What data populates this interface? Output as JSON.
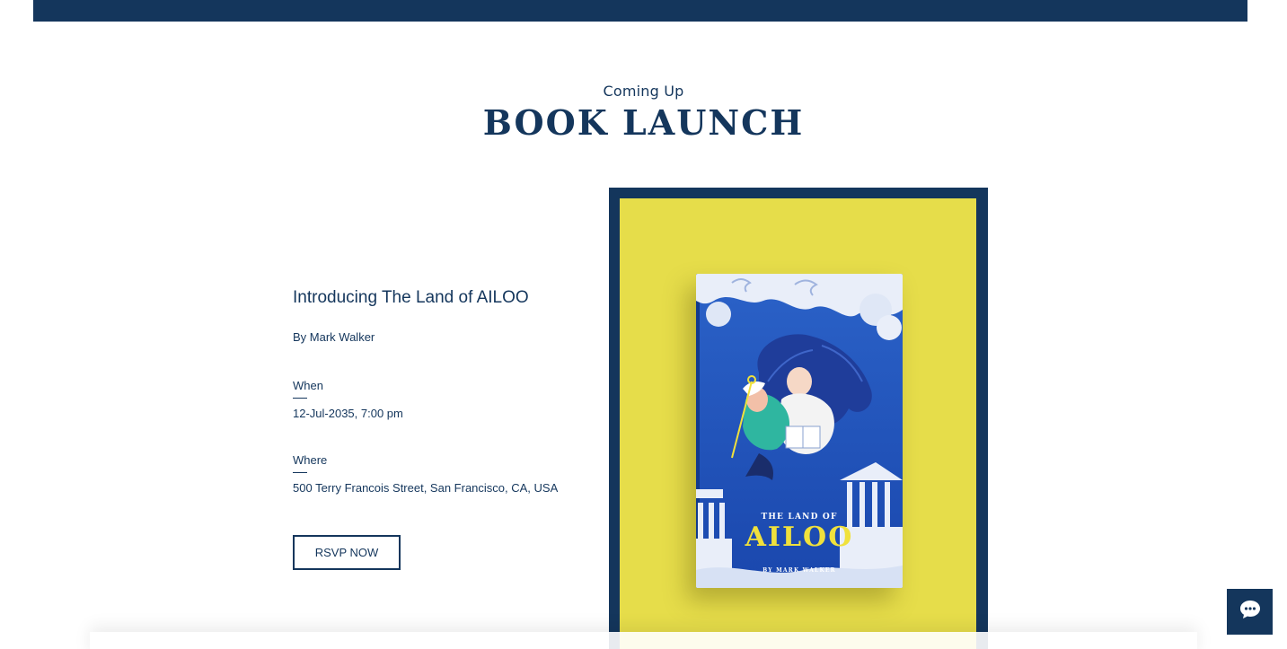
{
  "section": {
    "eyebrow": "Coming Up",
    "headline": "BOOK LAUNCH"
  },
  "event": {
    "title": "Introducing The Land of AILOO",
    "author": "By Mark Walker",
    "when_label": "When",
    "when_value": "12-Jul-2035, 7:00 pm",
    "where_label": "Where",
    "where_value": "500 Terry Francois Street, San Francisco, CA, USA",
    "rsvp_label": "RSVP NOW"
  },
  "book_cover": {
    "title_small": "THE LAND OF",
    "title_big": "AILOO",
    "author": "BY MARK WALKER"
  },
  "icons": {
    "chat": "chat-bubble-icon"
  },
  "colors": {
    "navy": "#14365c",
    "yellow": "#e6dd4a",
    "cover_blue": "#1c4fb8",
    "accent_yellow": "#f0e13c"
  }
}
